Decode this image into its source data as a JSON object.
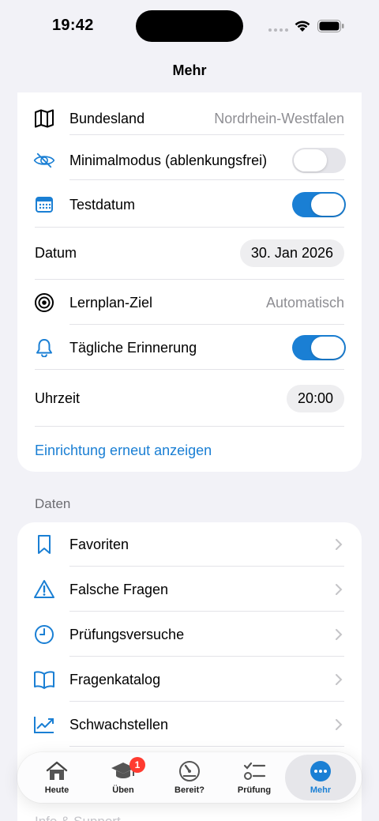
{
  "status": {
    "time": "19:42"
  },
  "nav": {
    "title": "Mehr"
  },
  "settings": {
    "bundesland": {
      "label": "Bundesland",
      "value": "Nordrhein-Westfalen"
    },
    "minimalmodus": {
      "label": "Minimalmodus (ablenkungsfrei)",
      "enabled": false
    },
    "testdatum": {
      "label": "Testdatum",
      "enabled": true
    },
    "datum": {
      "label": "Datum",
      "value": "30. Jan 2026"
    },
    "lernplan": {
      "label": "Lernplan-Ziel",
      "value": "Automatisch"
    },
    "erinnerung": {
      "label": "Tägliche Erinnerung",
      "enabled": true
    },
    "uhrzeit": {
      "label": "Uhrzeit",
      "value": "20:00"
    },
    "setup_link": "Einrichtung erneut anzeigen"
  },
  "daten": {
    "header": "Daten",
    "items": [
      {
        "label": "Favoriten",
        "icon": "bookmark-icon"
      },
      {
        "label": "Falsche Fragen",
        "icon": "warning-triangle-icon"
      },
      {
        "label": "Prüfungsversuche",
        "icon": "clock-icon"
      },
      {
        "label": "Fragenkatalog",
        "icon": "open-book-icon"
      },
      {
        "label": "Schwachstellen",
        "icon": "trend-chart-icon"
      }
    ]
  },
  "next_section_header": "Info & Support",
  "tabbar": {
    "tabs": [
      {
        "label": "Heute",
        "icon": "house-icon"
      },
      {
        "label": "Üben",
        "icon": "graduation-cap-icon",
        "badge": "1"
      },
      {
        "label": "Bereit?",
        "icon": "gauge-icon"
      },
      {
        "label": "Prüfung",
        "icon": "checklist-icon"
      },
      {
        "label": "Mehr",
        "icon": "more-icon",
        "active": true
      }
    ]
  },
  "colors": {
    "accent": "#1a7fd4",
    "badge": "#ff3b30",
    "background": "#f2f2f7"
  }
}
